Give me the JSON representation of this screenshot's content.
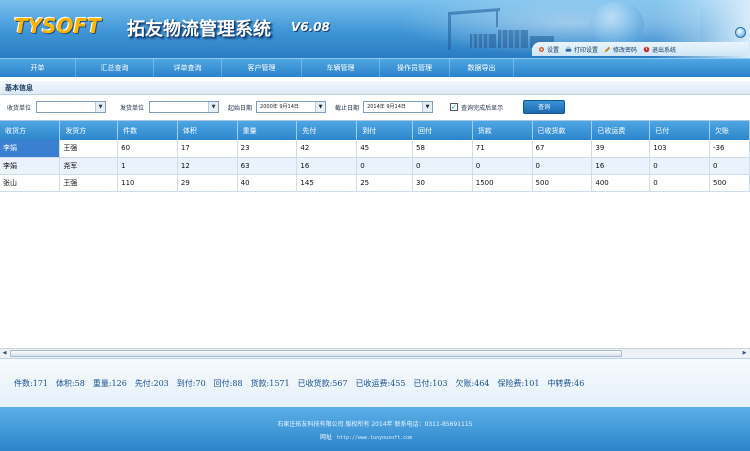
{
  "header": {
    "brand": "TYSOFT",
    "title": "拓友物流管理系统",
    "version": "V6.08",
    "links": [
      {
        "label": "设置",
        "icon": "settings-icon",
        "color": "#d35a2a"
      },
      {
        "label": "打印设置",
        "icon": "printer-icon",
        "color": "#2d6aa8"
      },
      {
        "label": "修改密码",
        "icon": "pencil-icon",
        "color": "#c48a1a"
      },
      {
        "label": "退出系统",
        "icon": "power-icon",
        "color": "#c8302a"
      }
    ]
  },
  "nav": {
    "items": [
      "开单",
      "汇总查询",
      "详单查询",
      "客户管理",
      "车辆管理",
      "操作员管理",
      "数据导出"
    ]
  },
  "filter": {
    "section_title": "基本信息",
    "receiver_label": "收货单位",
    "receiver_value": "",
    "sender_label": "发货单位",
    "sender_value": "",
    "start_label": "起始日期",
    "start_value": "2000年 9月14日",
    "end_label": "截止日期",
    "end_value": "2014年 9月14日",
    "only_unfinished_label": "查询完成后显示",
    "only_unfinished_checked": "✓",
    "query_button": "查询"
  },
  "table": {
    "columns": [
      "收货方",
      "发货方",
      "件数",
      "体积",
      "重量",
      "先付",
      "到付",
      "回付",
      "货款",
      "已收货款",
      "已收运费",
      "已付",
      "欠账"
    ],
    "rows": [
      [
        "李娟",
        "王强",
        "60",
        "17",
        "23",
        "42",
        "45",
        "58",
        "71",
        "67",
        "39",
        "103",
        "-36"
      ],
      [
        "李娟",
        "尧军",
        "1",
        "12",
        "63",
        "16",
        "0",
        "0",
        "0",
        "0",
        "16",
        "0",
        "0"
      ],
      [
        "张山",
        "王强",
        "110",
        "29",
        "40",
        "145",
        "25",
        "30",
        "1500",
        "500",
        "400",
        "0",
        "500"
      ]
    ]
  },
  "summary": {
    "items": [
      "件数:171",
      "体积:58",
      "重量:126",
      "先付:203",
      "到付:70",
      "回付:88",
      "货款:1571",
      "已收货款:567",
      "已收运费:455",
      "已付:103",
      "欠账:464",
      "保险费:101",
      "中转费:46"
    ]
  },
  "footer": {
    "copyright": "石家庄拓友科技有限公司 版权所有 2014年 联系电话：0311-85691115",
    "website_label": "网址",
    "website_url": "http://www.tuoyousoft.com"
  },
  "colors": {
    "header_blue": "#2a7cc2",
    "brand_orange": "#ffb400",
    "selected_cell": "#3a7fd0",
    "summary_text": "#1a4f8f"
  }
}
